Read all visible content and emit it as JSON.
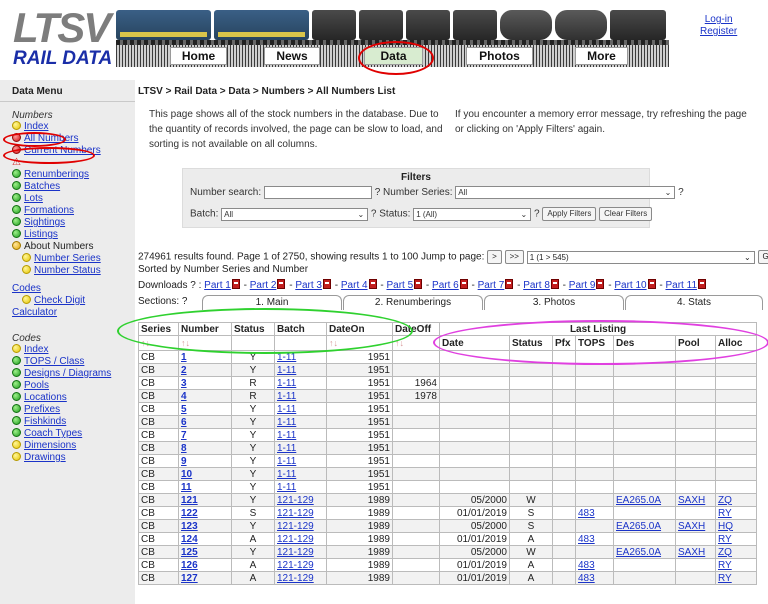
{
  "header": {
    "logo_letters": "LTSV",
    "logo_sub": "RAIL DATA",
    "auth": {
      "login": "Log-in",
      "register": "Register"
    },
    "nav": [
      {
        "label": "Home"
      },
      {
        "label": "News"
      },
      {
        "label": "Data",
        "active": true
      },
      {
        "label": "Photos"
      },
      {
        "label": "More"
      }
    ]
  },
  "sidebar": {
    "title": "Data Menu",
    "numbers_heading": "Numbers",
    "numbers_items": [
      {
        "label": "Index",
        "dot": "yellow"
      },
      {
        "label": "All Numbers",
        "dot": "red"
      },
      {
        "label": "Current Numbers",
        "dot": "red"
      },
      {
        "label": "⚠",
        "dot": ""
      },
      {
        "label": "Renumberings",
        "dot": "green"
      },
      {
        "label": "Batches",
        "dot": "green"
      },
      {
        "label": "Lots",
        "dot": "green"
      },
      {
        "label": "Formations",
        "dot": "green"
      },
      {
        "label": "Sightings",
        "dot": "green"
      },
      {
        "label": "Listings",
        "dot": "green"
      },
      {
        "label": "About Numbers",
        "dot": "orange"
      },
      {
        "label": "Number Series",
        "dot": "yellow",
        "sub": true
      },
      {
        "label": "Number Status",
        "dot": "yellow",
        "sub": true
      }
    ],
    "codes_link": "Codes",
    "check_digit": "Check Digit",
    "calculator": "Calculator",
    "codes_heading": "Codes",
    "codes_items": [
      {
        "label": "Index",
        "dot": "yellow"
      },
      {
        "label": "TOPS / Class",
        "dot": "green"
      },
      {
        "label": "Designs / Diagrams",
        "dot": "green"
      },
      {
        "label": "Pools",
        "dot": "green"
      },
      {
        "label": "Locations",
        "dot": "green"
      },
      {
        "label": "Prefixes",
        "dot": "green"
      },
      {
        "label": "Fishkinds",
        "dot": "green"
      },
      {
        "label": "Coach Types",
        "dot": "green"
      },
      {
        "label": "Dimensions",
        "dot": "yellow"
      },
      {
        "label": "Drawings",
        "dot": "yellow"
      }
    ]
  },
  "main": {
    "breadcrumb": "LTSV > Rail Data > Data > Numbers > All Numbers List",
    "intro_left": "This page shows all of the stock numbers in the database. Due to the quantity of records involved, the page can be slow to load, and sorting is not available on all columns.",
    "intro_right": "If you encounter a memory error message, try refreshing the page or clicking on 'Apply Filters' again.",
    "filters": {
      "title": "Filters",
      "number_search_label": "Number search:",
      "number_search_value": "",
      "q1": "?",
      "number_series_label": "Number Series:",
      "number_series_value": "All",
      "q2": "?",
      "batch_label": "Batch:",
      "batch_value": "All",
      "q3": "?",
      "status_label": "Status:",
      "status_value": "1 (All)",
      "q4": "?",
      "apply": "Apply Filters",
      "clear": "Clear Filters"
    },
    "results_text": "274961 results found. Page 1 of 2750, showing results 1 to 100  Jump to page:",
    "jump_next": ">",
    "jump_last": ">>",
    "page_select": "1 (1 > 545)",
    "go": "Go",
    "sorted_text": "Sorted by Number Series and Number",
    "downloads_label": "Downloads ? :",
    "downloads": [
      "Part 1",
      "Part 2",
      "Part 3",
      "Part 4",
      "Part 5",
      "Part 6",
      "Part 7",
      "Part 8",
      "Part 9",
      "Part 10",
      "Part 11"
    ],
    "sections_label": "Sections: ?",
    "sections": [
      "1. Main",
      "2. Renumberings",
      "3. Photos",
      "4. Stats"
    ]
  },
  "table": {
    "headers": [
      "Series",
      "Number",
      "Status",
      "Batch",
      "DateOn",
      "DateOff"
    ],
    "last_listing": "Last Listing",
    "sub_headers": [
      "Date",
      "Status",
      "Pfx",
      "TOPS",
      "Des",
      "Pool",
      "Alloc"
    ],
    "sort_marks": [
      "↑↓",
      "↑↓",
      "",
      "",
      "↑↓",
      "↑↓"
    ],
    "rows": [
      [
        "CB",
        "1",
        "Y",
        "1-11",
        "1951",
        "",
        "",
        "",
        "",
        "",
        "",
        "",
        ""
      ],
      [
        "CB",
        "2",
        "Y",
        "1-11",
        "1951",
        "",
        "",
        "",
        "",
        "",
        "",
        "",
        ""
      ],
      [
        "CB",
        "3",
        "R",
        "1-11",
        "1951",
        "1964",
        "",
        "",
        "",
        "",
        "",
        "",
        ""
      ],
      [
        "CB",
        "4",
        "R",
        "1-11",
        "1951",
        "1978",
        "",
        "",
        "",
        "",
        "",
        "",
        ""
      ],
      [
        "CB",
        "5",
        "Y",
        "1-11",
        "1951",
        "",
        "",
        "",
        "",
        "",
        "",
        "",
        ""
      ],
      [
        "CB",
        "6",
        "Y",
        "1-11",
        "1951",
        "",
        "",
        "",
        "",
        "",
        "",
        "",
        ""
      ],
      [
        "CB",
        "7",
        "Y",
        "1-11",
        "1951",
        "",
        "",
        "",
        "",
        "",
        "",
        "",
        ""
      ],
      [
        "CB",
        "8",
        "Y",
        "1-11",
        "1951",
        "",
        "",
        "",
        "",
        "",
        "",
        "",
        ""
      ],
      [
        "CB",
        "9",
        "Y",
        "1-11",
        "1951",
        "",
        "",
        "",
        "",
        "",
        "",
        "",
        ""
      ],
      [
        "CB",
        "10",
        "Y",
        "1-11",
        "1951",
        "",
        "",
        "",
        "",
        "",
        "",
        "",
        ""
      ],
      [
        "CB",
        "11",
        "Y",
        "1-11",
        "1951",
        "",
        "",
        "",
        "",
        "",
        "",
        "",
        ""
      ],
      [
        "CB",
        "121",
        "Y",
        "121-129",
        "1989",
        "",
        "05/2000",
        "W",
        "",
        "",
        "EA265.0A",
        "SAXH",
        "ZQ"
      ],
      [
        "CB",
        "122",
        "S",
        "121-129",
        "1989",
        "",
        "01/01/2019",
        "S",
        "",
        "483",
        "",
        "",
        "RY"
      ],
      [
        "CB",
        "123",
        "Y",
        "121-129",
        "1989",
        "",
        "05/2000",
        "S",
        "",
        "",
        "EA265.0A",
        "SAXH",
        "HQ"
      ],
      [
        "CB",
        "124",
        "A",
        "121-129",
        "1989",
        "",
        "01/01/2019",
        "A",
        "",
        "483",
        "",
        "",
        "RY"
      ],
      [
        "CB",
        "125",
        "Y",
        "121-129",
        "1989",
        "",
        "05/2000",
        "W",
        "",
        "",
        "EA265.0A",
        "SAXH",
        "ZQ"
      ],
      [
        "CB",
        "126",
        "A",
        "121-129",
        "1989",
        "",
        "01/01/2019",
        "A",
        "",
        "483",
        "",
        "",
        "RY"
      ],
      [
        "CB",
        "127",
        "A",
        "121-129",
        "1989",
        "",
        "01/01/2019",
        "A",
        "",
        "483",
        "",
        "",
        "RY"
      ]
    ]
  },
  "colors": {
    "link": "#1a33c8",
    "logo_blue": "#1a2ea8",
    "annot_red": "#e00000",
    "annot_green": "#2fd12f",
    "annot_magenta": "#e040e0"
  }
}
